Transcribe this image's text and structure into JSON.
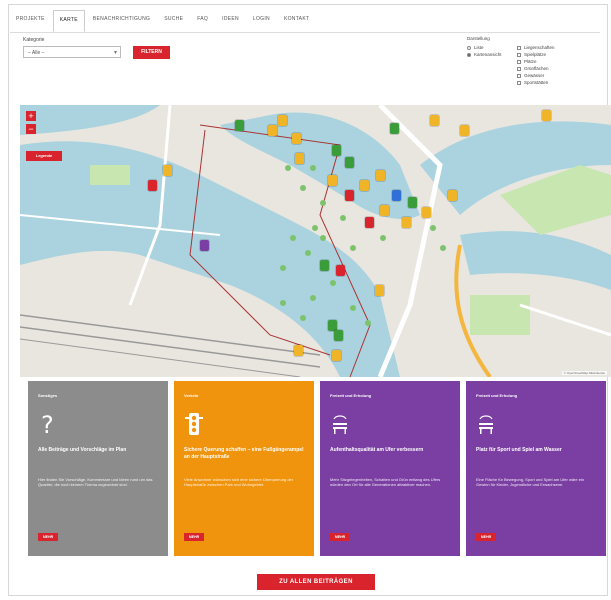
{
  "tabs": [
    "PROJEKTE",
    "KARTE",
    "BENACHRICHTIGUNG",
    "SUCHE",
    "FAQ",
    "IDEEN",
    "LOGIN",
    "KONTAKT"
  ],
  "filter": {
    "label": "Kategorie",
    "select_value": "– Alle –",
    "button_label": "FILTERN"
  },
  "display": {
    "title": "Darstellung",
    "options": [
      "Liste",
      "Kartenansicht"
    ],
    "selected": 1
  },
  "layers": [
    "Liegenschaften",
    "Spielplätze",
    "Plätze",
    "Grünflächen",
    "Gewässer",
    "Sportstätten"
  ],
  "map": {
    "zoom_in": "+",
    "zoom_out": "−",
    "tag_label": "Legende",
    "attribution": "© OpenStreetMap-Mitwirkende"
  },
  "cards": [
    {
      "category": "Sonstiges",
      "title": "Alle Beiträge und Vorschläge im Plan",
      "body": "Hier finden Sie Vorschläge, Kommentare und Ideen rund um das Quartier, die noch keinem Thema zugeordnet sind.",
      "more": "MEHR",
      "color": "#8c8c8c",
      "icon": "question-icon"
    },
    {
      "category": "Verkehr",
      "title": "Sichere Querung schaffen – eine Fußgängerampel an der Hauptstraße",
      "body": "Viele Anwohner wünschen sich eine sichere Überquerung der Hauptstraße zwischen Park und Wohngebiet.",
      "more": "MEHR",
      "color": "#f0930d",
      "icon": "traffic-light-icon"
    },
    {
      "category": "Freizeit und Erholung",
      "title": "Aufenthaltsqualität am Ufer verbessern",
      "body": "Mehr Sitzgelegenheiten, Schatten und Grün entlang des Ufers würden den Ort für alle Generationen attraktiver machen.",
      "more": "MEHR",
      "color": "#7b3fa3",
      "icon": "bench-icon"
    },
    {
      "category": "Freizeit und Erholung",
      "title": "Platz für Sport und Spiel am Wasser",
      "body": "Eine Fläche für Bewegung, Sport und Spiel am Ufer wäre ein Gewinn für Kinder, Jugendliche und Erwachsene.",
      "more": "MEHR",
      "color": "#7b3fa3",
      "icon": "bench-icon"
    }
  ],
  "bottom_button": "ZU ALLEN BEITRÄGEN",
  "colors": {
    "accent": "#d9232d",
    "water": "#aad3df",
    "land": "#e9e6df",
    "park": "#c8e6b0"
  }
}
